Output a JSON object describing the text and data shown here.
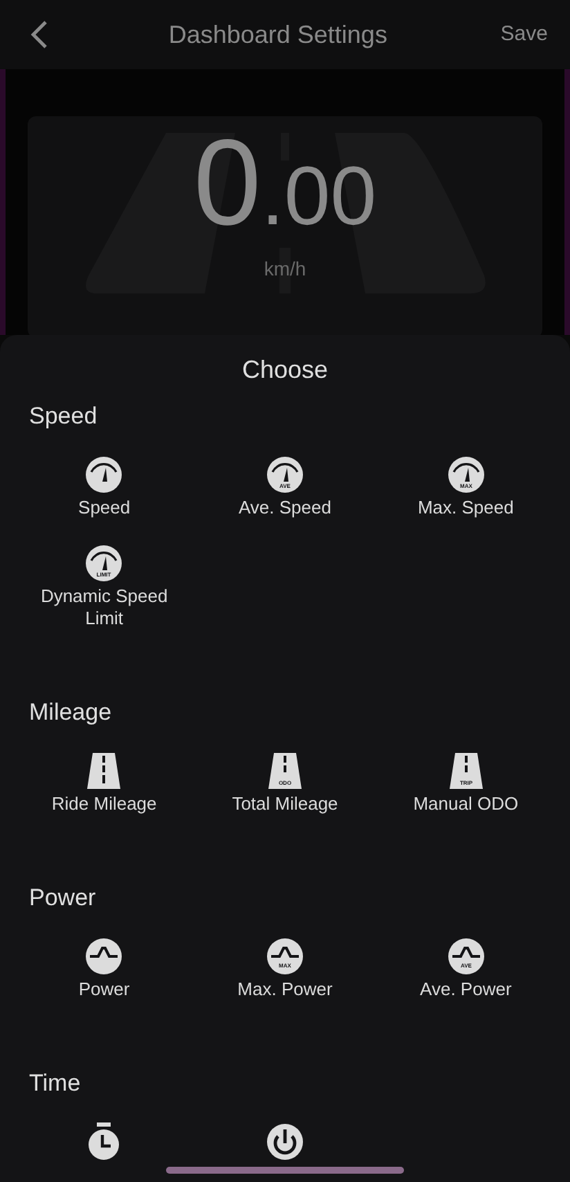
{
  "header": {
    "title": "Dashboard Settings",
    "action": "Save"
  },
  "preview": {
    "value": "0",
    "decimals": ".00",
    "unit": "km/h"
  },
  "sheet": {
    "title": "Choose",
    "sections": [
      {
        "heading": "Speed",
        "items": [
          {
            "kind": "gauge",
            "label": "Speed"
          },
          {
            "kind": "gauge",
            "badge": "AVE",
            "label": "Ave. Speed"
          },
          {
            "kind": "gauge",
            "badge": "MAX",
            "label": "Max. Speed"
          },
          {
            "kind": "gauge",
            "badge": "LIMIT",
            "label": "Dynamic Speed Limit"
          }
        ]
      },
      {
        "heading": "Mileage",
        "items": [
          {
            "kind": "road",
            "label": "Ride Mileage"
          },
          {
            "kind": "road",
            "badge": "ODO",
            "label": "Total Mileage"
          },
          {
            "kind": "road",
            "badge": "TRIP",
            "label": "Manual ODO"
          }
        ]
      },
      {
        "heading": "Power",
        "items": [
          {
            "kind": "power",
            "label": "Power"
          },
          {
            "kind": "power",
            "badge": "MAX",
            "label": "Max. Power"
          },
          {
            "kind": "power",
            "badge": "AVE",
            "label": "Ave. Power"
          }
        ]
      },
      {
        "heading": "Time",
        "items": [
          {
            "kind": "timer"
          },
          {
            "kind": "standby"
          }
        ]
      }
    ]
  }
}
